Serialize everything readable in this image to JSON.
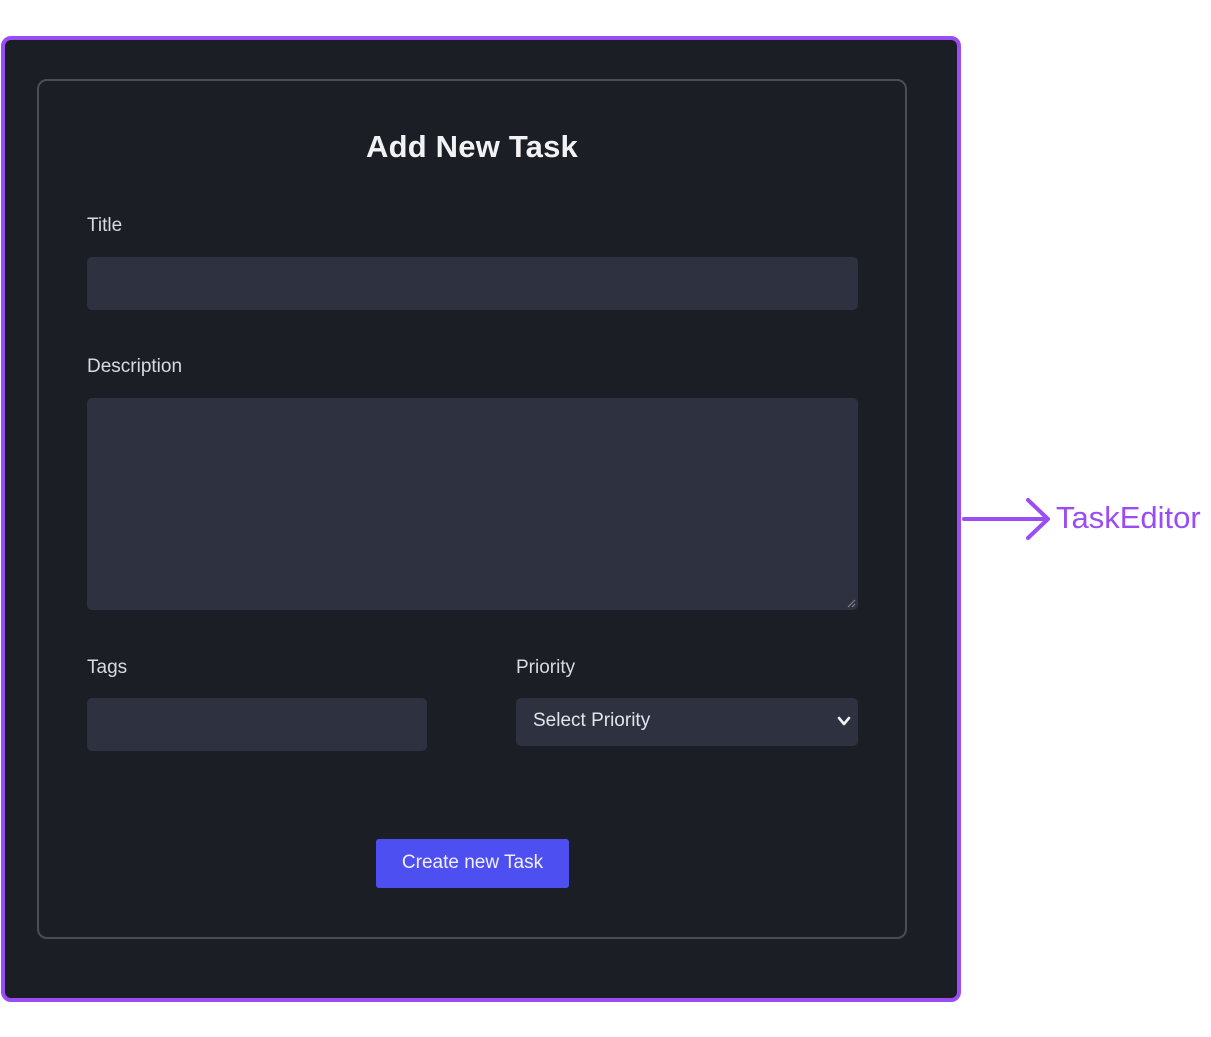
{
  "form": {
    "title": "Add New Task",
    "title_label": "Title",
    "title_value": "",
    "description_label": "Description",
    "description_value": "",
    "tags_label": "Tags",
    "tags_value": "",
    "priority_label": "Priority",
    "priority_selected": "Select Priority",
    "submit_label": "Create new Task"
  },
  "annotation": {
    "label": "TaskEditor",
    "icon": "arrow-right-icon"
  },
  "colors": {
    "frame_border": "#9a4cf5",
    "background": "#1c1e26",
    "field": "#2e313f",
    "button": "#4d4ff0"
  }
}
